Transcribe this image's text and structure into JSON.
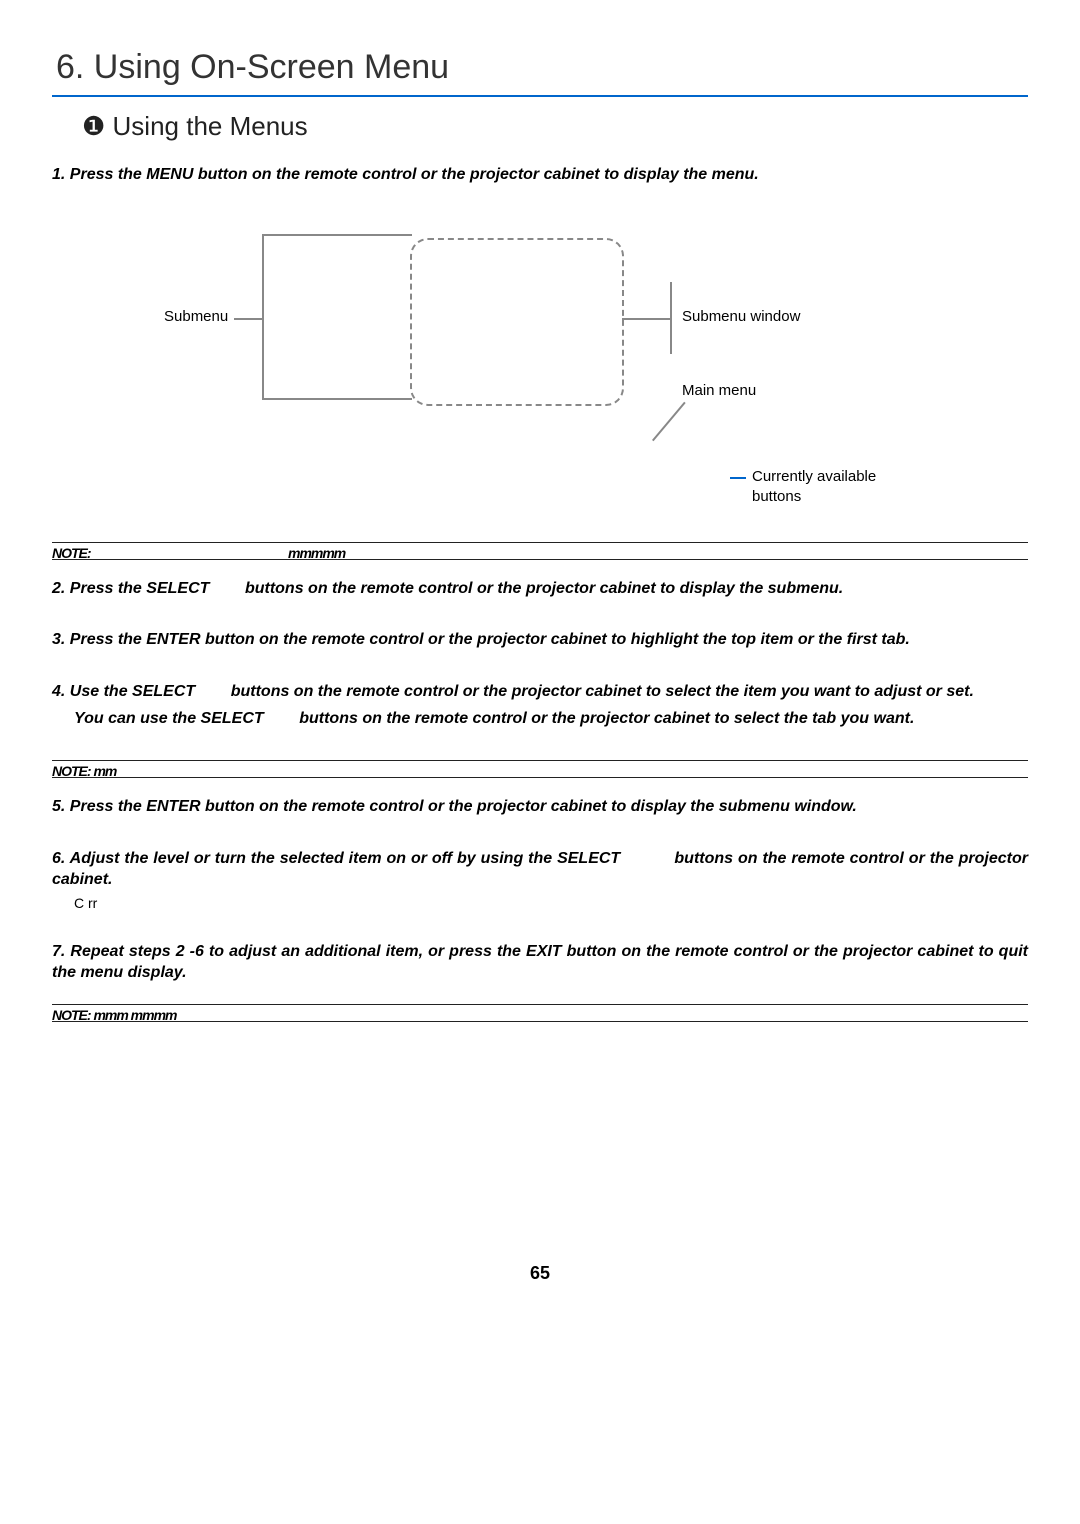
{
  "chapter_title": "6. Using On-Screen Menu",
  "section_title": "❶ Using the Menus",
  "step1": "1. Press the MENU button on the remote control or the projector cabinet to display the menu.",
  "diagram": {
    "label_submenu": "Submenu",
    "label_submenu_window": "Submenu window",
    "label_main_menu": "Main menu",
    "label_buttons_line1": "Currently available",
    "label_buttons_line2": "buttons"
  },
  "note1_left": "NOTE:",
  "note1_right": "mmmmm",
  "step2": "2. Press the SELECT        buttons on the remote control or the projector cabinet to display the submenu.",
  "step3": "3. Press the ENTER button on the remote control or the projector cabinet to highlight the top item or the first tab.",
  "step4_line1": "4. Use the SELECT        buttons on the remote control or the projector cabinet to select the item you want to adjust or set.",
  "step4_line2": "You can use the SELECT        buttons on the remote control or the projector cabinet to select the tab you want.",
  "note2": "NOTE: mm",
  "step5": "5. Press the ENTER button on the remote control or the projector cabinet to display the submenu window.",
  "step6_line1": "6. Adjust the level or turn the selected item on or off by using the SELECT           buttons on the remote control or the projector cabinet.",
  "step6_line2": "C rr",
  "step7": "7. Repeat steps 2 -6 to adjust an additional item, or press the EXIT button on the remote control or the projector cabinet to quit the menu display.",
  "note3": "NOTE: mmm mmmm",
  "page_number": "65"
}
